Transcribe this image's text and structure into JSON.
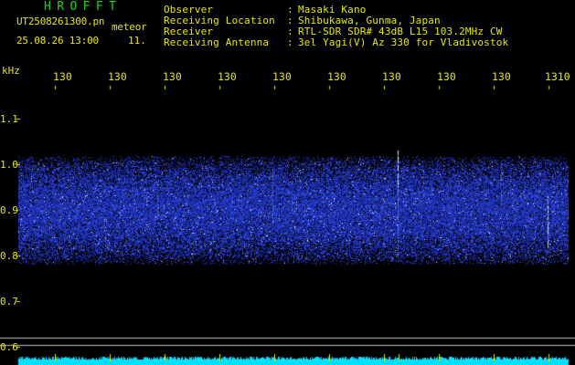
{
  "header": {
    "app_title": "HROFFT",
    "file_name": "UT2508261300.pn",
    "file_tag": "meteor",
    "date_time": "25.08.26 13:00",
    "counter": "11."
  },
  "station_info": [
    {
      "label": "Observer",
      "value": "Masaki Kano"
    },
    {
      "label": "Receiving Location",
      "value": "Shibukawa, Gunma, Japan"
    },
    {
      "label": "Receiver",
      "value": "RTL-SDR SDR# 43dB L15 103.2MHz CW"
    },
    {
      "label": "Receiving Antenna",
      "value": "3el Yagi(V) Az 330 for Vladivostok"
    }
  ],
  "separator": ":",
  "axis": {
    "unit_label": "kHz",
    "x_tick_labels": [
      "130",
      "130",
      "130",
      "130",
      "130",
      "130",
      "130",
      "130",
      "130",
      "1310"
    ],
    "y_tick_labels": [
      "1.1",
      "1.0",
      "0.9",
      "0.8",
      "0.7",
      "0.6"
    ]
  },
  "colors": {
    "background": "#000000",
    "text": "#e8e800",
    "title": "#18d818",
    "noise_band": "#1a2cd8",
    "signal_trace": "#ffffa0",
    "bottom_spectrum": "#00e0ff"
  }
}
